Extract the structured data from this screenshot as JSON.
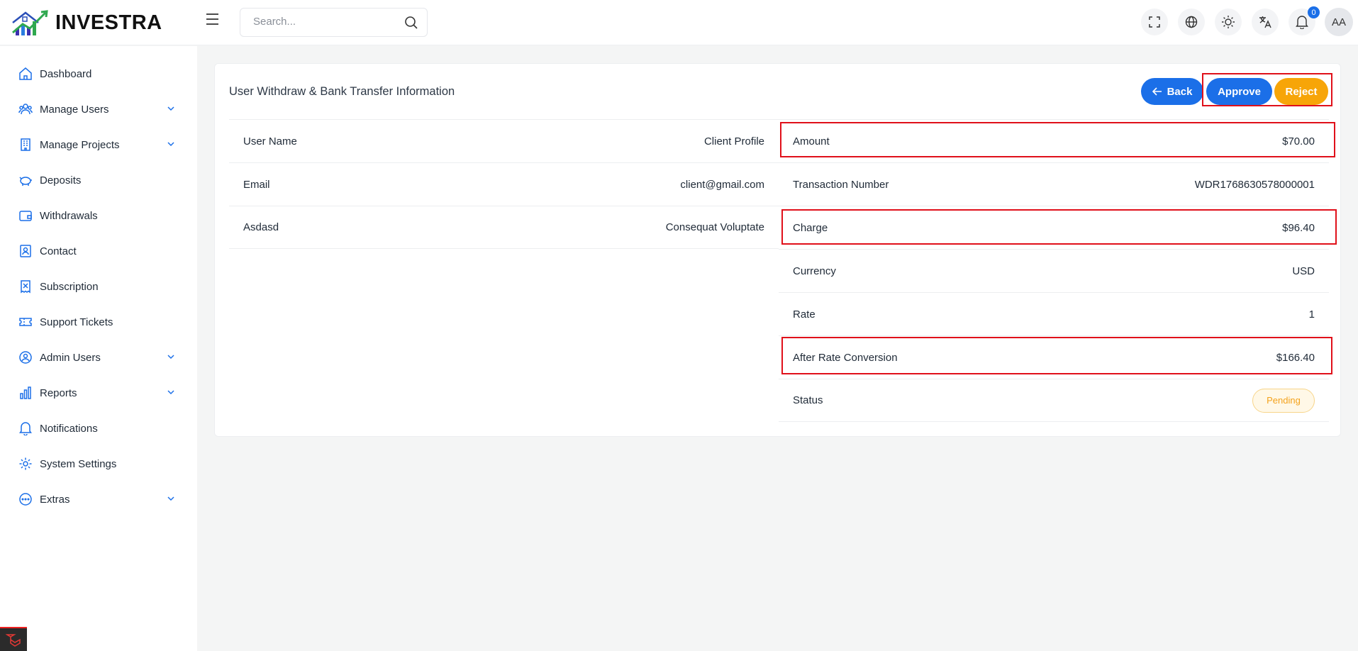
{
  "brand": {
    "name": "INVESTRA"
  },
  "header": {
    "search_placeholder": "Search...",
    "notification_count": "0",
    "avatar_initials": "AA"
  },
  "sidebar": {
    "items": [
      {
        "label": "Dashboard",
        "icon": "home-icon",
        "expandable": false
      },
      {
        "label": "Manage Users",
        "icon": "users-icon",
        "expandable": true
      },
      {
        "label": "Manage Projects",
        "icon": "building-icon",
        "expandable": true
      },
      {
        "label": "Deposits",
        "icon": "piggy-bank-icon",
        "expandable": false
      },
      {
        "label": "Withdrawals",
        "icon": "wallet-icon",
        "expandable": false
      },
      {
        "label": "Contact",
        "icon": "contact-icon",
        "expandable": false
      },
      {
        "label": "Subscription",
        "icon": "subscription-icon",
        "expandable": false
      },
      {
        "label": "Support Tickets",
        "icon": "ticket-icon",
        "expandable": false
      },
      {
        "label": "Admin Users",
        "icon": "admin-icon",
        "expandable": true
      },
      {
        "label": "Reports",
        "icon": "chart-icon",
        "expandable": true
      },
      {
        "label": "Notifications",
        "icon": "bell-icon",
        "expandable": false
      },
      {
        "label": "System Settings",
        "icon": "gear-icon",
        "expandable": false
      },
      {
        "label": "Extras",
        "icon": "dots-circle-icon",
        "expandable": true
      }
    ]
  },
  "page": {
    "title": "User Withdraw & Bank Transfer Information",
    "back_label": "Back",
    "approve_label": "Approve",
    "reject_label": "Reject"
  },
  "user_info": [
    {
      "label": "User Name",
      "value": "Client Profile"
    },
    {
      "label": "Email",
      "value": "client@gmail.com"
    },
    {
      "label": "Asdasd",
      "value": "Consequat Voluptate"
    }
  ],
  "transaction_info": [
    {
      "label": "Amount",
      "value": "$70.00"
    },
    {
      "label": "Transaction Number",
      "value": "WDR1768630578000001"
    },
    {
      "label": "Charge",
      "value": "$96.40"
    },
    {
      "label": "Currency",
      "value": "USD"
    },
    {
      "label": "Rate",
      "value": "1"
    },
    {
      "label": "After Rate Conversion",
      "value": "$166.40"
    }
  ],
  "status": {
    "label": "Status",
    "value": "Pending"
  },
  "colors": {
    "primary": "#1b6fe8",
    "warning": "#f7a508",
    "highlight": "#e0101a"
  }
}
